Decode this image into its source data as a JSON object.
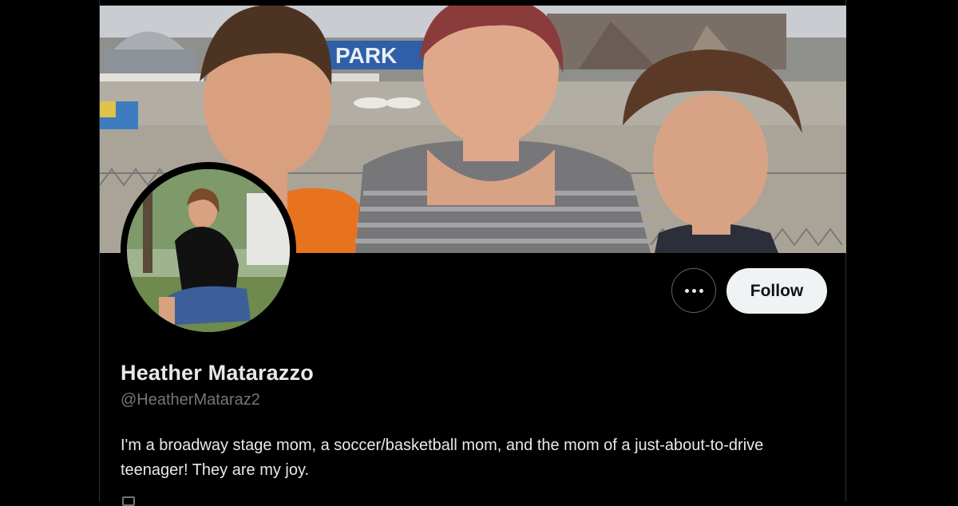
{
  "profile": {
    "display_name": "Heather Matarazzo",
    "handle": "@HeatherMataraz2",
    "bio": "I'm a broadway stage mom, a soccer/basketball mom, and the mom of a just-about-to-drive teenager! They are my joy."
  },
  "banner": {
    "sign_text": "PARK"
  },
  "actions": {
    "follow_label": "Follow",
    "more_icon": "ellipsis-icon"
  },
  "colors": {
    "background": "#000000",
    "text_primary": "#e7e9ea",
    "text_secondary": "#71767b",
    "follow_button_bg": "#eff3f4",
    "follow_button_text": "#0f1419"
  }
}
